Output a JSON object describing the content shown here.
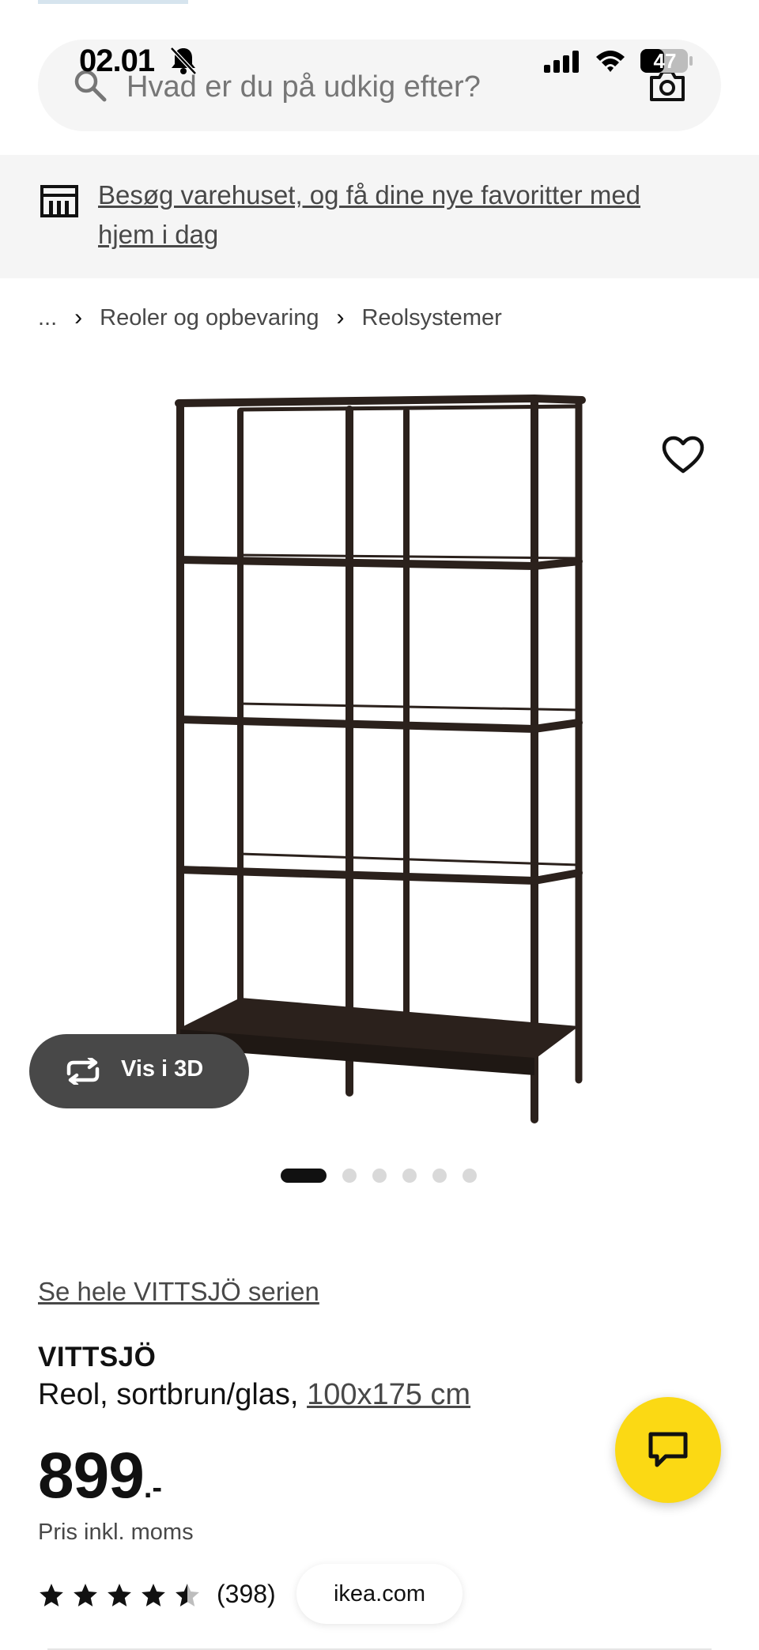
{
  "status_bar": {
    "time": "02.01",
    "battery": "47",
    "icons": [
      "bell-slash-icon",
      "cellular-signal-icon",
      "wifi-icon",
      "battery-icon"
    ]
  },
  "search": {
    "placeholder": "Hvad er du på udkig efter?",
    "icons": [
      "search-icon",
      "camera-icon"
    ]
  },
  "store_banner": {
    "link_text": "Besøg varehuset, og få dine nye favoritter med hjem i dag",
    "icon": "store-icon"
  },
  "breadcrumb": {
    "ellipsis": "...",
    "separator": "›",
    "items": [
      "Reoler og opbevaring",
      "Reolsystemer"
    ]
  },
  "gallery": {
    "view_3d_label": "Vis i 3D",
    "image_count": 6,
    "active_index": 0,
    "icons": [
      "heart-icon",
      "rotate-3d-icon"
    ]
  },
  "product": {
    "series_link": "Se hele VITTSJÖ serien",
    "name": "VITTSJÖ",
    "description": "Reol, sortbrun/glas, ",
    "size": "100x175 cm",
    "price_integer": "899",
    "price_suffix": ".-",
    "price_note": "Pris inkl. moms",
    "rating": 4.5,
    "rating_max": 5,
    "rating_count": "(398)"
  },
  "browser": {
    "domain": "ikea.com"
  },
  "chat": {
    "icon": "chat-bubble-icon"
  },
  "colors": {
    "brand_yellow": "#fbd914",
    "text_primary": "#111111",
    "text_secondary": "#484848",
    "banner_bg": "#f5f5f5",
    "button_dark": "#484848"
  }
}
